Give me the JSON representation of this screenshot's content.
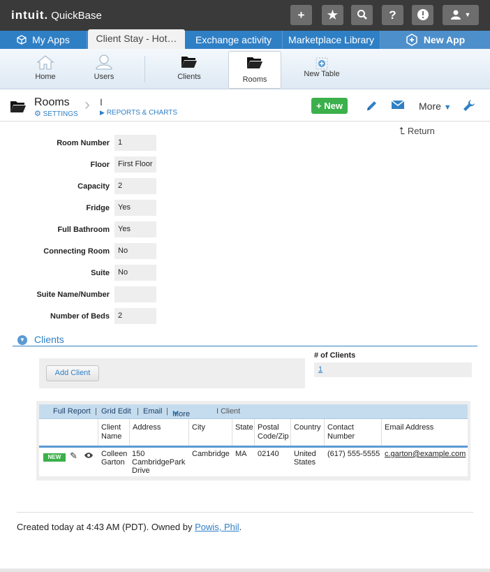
{
  "topbar": {
    "brand_main": "intuit.",
    "brand_product": "QuickBase",
    "buttons": [
      {
        "name": "add",
        "glyph": "+"
      },
      {
        "name": "favorite",
        "glyph": "★"
      },
      {
        "name": "search",
        "glyph": "⚲"
      },
      {
        "name": "help",
        "glyph": "?"
      },
      {
        "name": "alert",
        "glyph": "!"
      },
      {
        "name": "user",
        "glyph": "👤 ▾"
      }
    ]
  },
  "tabs": [
    {
      "label": "My Apps",
      "icon": "cube-icon"
    },
    {
      "label": "Client Stay - Hot…"
    },
    {
      "label": "Exchange activity"
    },
    {
      "label": "Marketplace Library"
    },
    {
      "label": "New App",
      "icon": "hexagon-plus-icon"
    }
  ],
  "nav": [
    {
      "label": "Home"
    },
    {
      "label": "Users"
    },
    {
      "label": "Clients"
    },
    {
      "label": "Rooms"
    },
    {
      "label": "New Table"
    }
  ],
  "header": {
    "title": "Rooms",
    "settings_label": "SETTINGS",
    "pipe": "I",
    "reports_label": "REPORTS & CHARTS",
    "new_label": "+ New",
    "more_label": "More"
  },
  "return_label": "Return",
  "form": {
    "fields": [
      {
        "label": "Room Number",
        "value": "1"
      },
      {
        "label": "Floor",
        "value": "First Floor"
      },
      {
        "label": "Capacity",
        "value": "2"
      },
      {
        "label": "Fridge",
        "value": "Yes"
      },
      {
        "label": "Full Bathroom",
        "value": "Yes"
      },
      {
        "label": "Connecting Room",
        "value": "No"
      },
      {
        "label": "Suite",
        "value": "No"
      },
      {
        "label": "Suite Name/Number",
        "value": ""
      },
      {
        "label": "Number of Beds",
        "value": "2"
      }
    ]
  },
  "clients_section": {
    "title": "Clients",
    "add_button": "Add  Client",
    "count_label": "# of Clients",
    "count_value": "1"
  },
  "report": {
    "toolbar": {
      "full_report": "Full Report",
      "grid_edit": "Grid Edit",
      "email": "Email",
      "more": "More",
      "sep": "|",
      "client_label": "I  Client"
    },
    "columns": [
      "Client Name",
      "Address",
      "City",
      "State",
      "Postal Code/Zip",
      "Country",
      "Contact Number",
      "Email Address"
    ],
    "row": {
      "badge": "NEW",
      "client_name": "Colleen Garton",
      "address": "150 CambridgePark Drive",
      "city": "Cambridge",
      "state": "MA",
      "zip": "02140",
      "country": "United States",
      "contact": "(617) 555-5555",
      "email": "c.garton@example.com"
    }
  },
  "footer": {
    "prefix": "Created today at  4:43 AM (PDT). Owned by ",
    "owner": "Powis, Phil",
    "suffix": "."
  },
  "colors": {
    "accent_blue": "#2f7fc5",
    "new_green": "#3bb04b",
    "topbar_dark": "#3a3a3a"
  }
}
